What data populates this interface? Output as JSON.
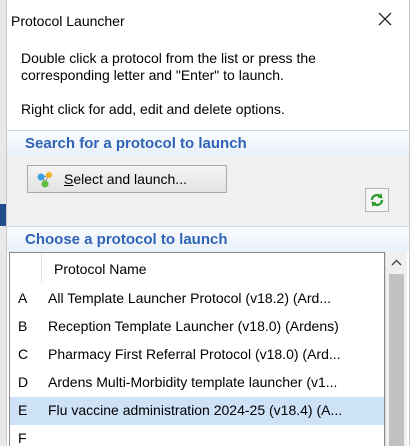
{
  "window": {
    "title": "Protocol Launcher",
    "close_icon": "close-icon"
  },
  "description": {
    "line1": "Double click a protocol from the list or press the corresponding letter and \"Enter\" to launch.",
    "line2": "Right click for add, edit and delete options."
  },
  "search_section": {
    "header": "Search for a protocol to launch",
    "select_button_label_accel": "S",
    "select_button_label_rest": "elect and launch...",
    "refresh_icon": "refresh-icon"
  },
  "choose_section": {
    "header": "Choose a protocol to launch"
  },
  "protocol_list": {
    "column_header": "Protocol Name",
    "rows": [
      {
        "key": "A",
        "name": "All Template Launcher Protocol (v18.2) (Ard..."
      },
      {
        "key": "B",
        "name": "Reception Template Launcher (v18.0) (Ardens)"
      },
      {
        "key": "C",
        "name": "Pharmacy First Referral Protocol (v18.0) (Ard..."
      },
      {
        "key": "D",
        "name": "Ardens Multi-Morbidity template launcher (v1..."
      },
      {
        "key": "E",
        "name": "Flu vaccine administration 2024-25 (v18.4) (A...",
        "selected": true
      },
      {
        "key": "F",
        "name": ""
      }
    ]
  },
  "colors": {
    "section_header_text": "#2f63b5",
    "selected_row": "#cde1f7",
    "search_area_bg": "#f0f0f0"
  }
}
